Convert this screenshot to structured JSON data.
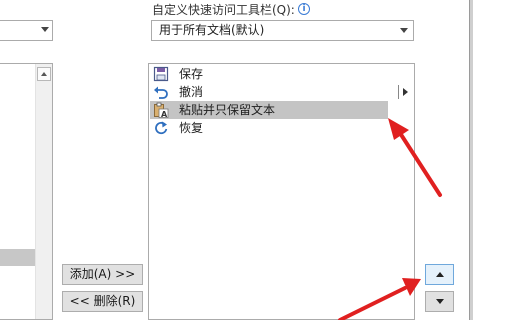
{
  "left_panel": {
    "dropdown_value": ""
  },
  "qat": {
    "label": "自定义快速访问工具栏(Q):",
    "info_glyph": "i",
    "scope_value": "用于所有文档(默认)",
    "items": [
      {
        "label": "保存",
        "icon": "save-icon"
      },
      {
        "label": "撤消",
        "icon": "undo-icon"
      },
      {
        "label": "粘贴并只保留文本",
        "icon": "paste-text-only-icon",
        "selected": true
      },
      {
        "label": "恢复",
        "icon": "redo-icon"
      }
    ]
  },
  "buttons": {
    "add": "添加(A) >>",
    "remove": "<< 删除(R)",
    "move_up": "move-up",
    "move_down": "move-down"
  },
  "annotation_color": "#e02020"
}
